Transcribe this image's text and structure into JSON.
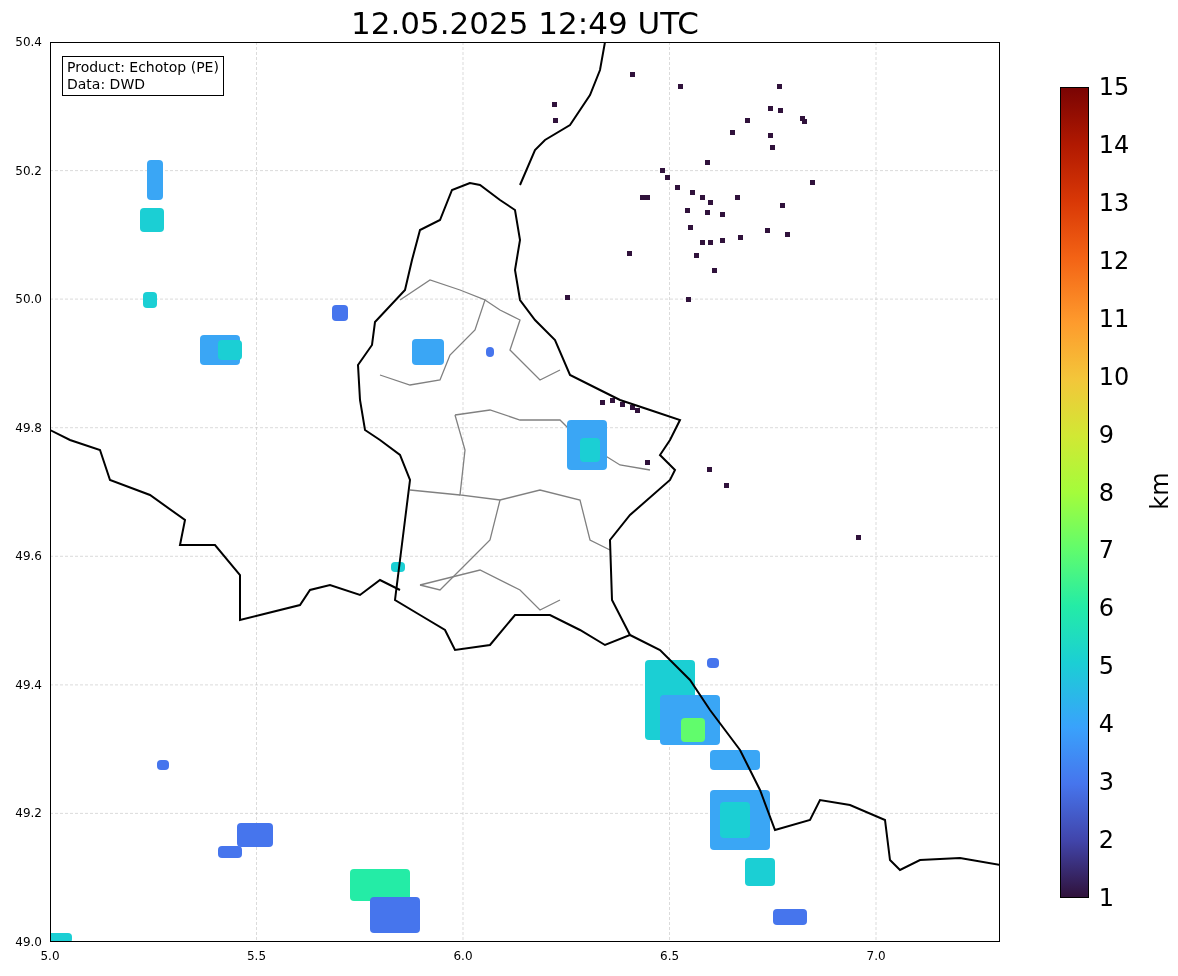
{
  "title": "12.05.2025 12:49 UTC",
  "info_box": [
    "Product: Echotop (PE)",
    "Data: DWD"
  ],
  "x_ticks": [
    "5.0",
    "5.5",
    "6.0",
    "6.5",
    "7.0"
  ],
  "y_ticks": [
    "50.4",
    "50.2",
    "50.0",
    "49.8",
    "49.6",
    "49.4",
    "49.2",
    "49.0"
  ],
  "colorbar": {
    "label": "km",
    "ticks": [
      "15",
      "14",
      "13",
      "12",
      "11",
      "10",
      "9",
      "8",
      "7",
      "6",
      "5",
      "4",
      "3",
      "2",
      "1"
    ]
  }
}
